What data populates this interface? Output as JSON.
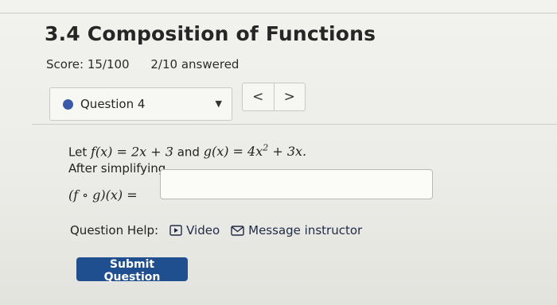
{
  "header": {
    "title": "3.4 Composition of Functions",
    "score": "Score: 15/100",
    "answered": "2/10 answered"
  },
  "question_nav": {
    "selected_question": "Question 4",
    "prev_label": "<",
    "next_label": ">"
  },
  "problem": {
    "intro": "Let ",
    "f_def": "f(x) = 2x + 3",
    "and": " and ",
    "g_def_base": "g(x) = 4x",
    "g_def_exp": "2",
    "g_def_rest": " + 3x.",
    "instruction": "After simplifying,",
    "composition": "(f ∘ g)(x) ="
  },
  "answer": {
    "value": ""
  },
  "help": {
    "label": "Question Help:",
    "video_label": "Video",
    "message_label": "Message instructor"
  },
  "submit": {
    "label": "Submit Question"
  },
  "colors": {
    "accent": "#1f4f8f",
    "question_dot": "#3a5aa8"
  }
}
